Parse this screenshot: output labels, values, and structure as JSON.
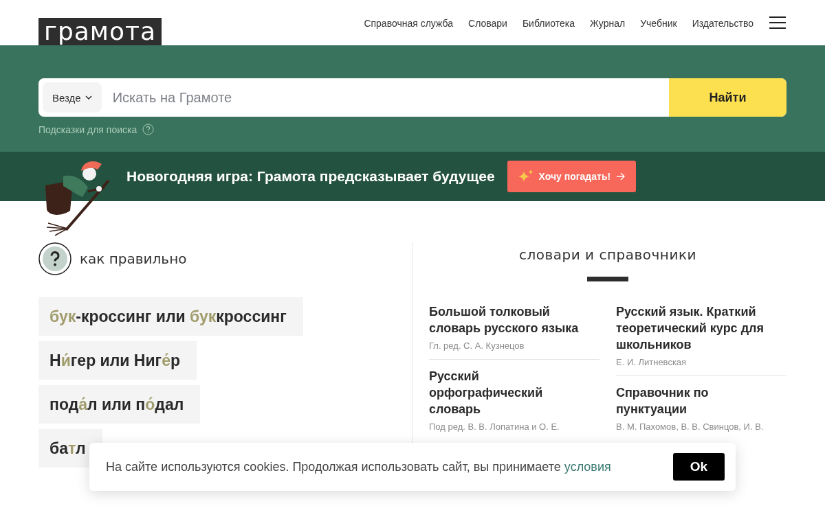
{
  "logo": "грамота",
  "nav": [
    "Справочная служба",
    "Словари",
    "Библиотека",
    "Журнал",
    "Учебник",
    "Издательство"
  ],
  "search": {
    "scope": "Везде",
    "placeholder": "Искать на Грамоте",
    "button": "Найти",
    "hint": "Подсказки для поиска"
  },
  "promo": {
    "text": "Новогодняя игра: Грамота предсказывает будущее",
    "button": "Хочу погадать!"
  },
  "how_to": {
    "title": "как правильно",
    "items": [
      {
        "parts": [
          {
            "text": "бук",
            "accent": true
          },
          {
            "text": "-кроссинг или ",
            "accent": false
          },
          {
            "text": "бук",
            "accent": true
          },
          {
            "text": "кроссинг",
            "accent": false
          }
        ]
      },
      {
        "parts": [
          {
            "text": "Н",
            "accent": false
          },
          {
            "text": "и́",
            "accent": true
          },
          {
            "text": "гер или Ниг",
            "accent": false
          },
          {
            "text": "е́",
            "accent": true
          },
          {
            "text": "р",
            "accent": false
          }
        ]
      },
      {
        "parts": [
          {
            "text": "под",
            "accent": false
          },
          {
            "text": "а́",
            "accent": true
          },
          {
            "text": "л или п",
            "accent": false
          },
          {
            "text": "о́",
            "accent": true
          },
          {
            "text": "дал",
            "accent": false
          }
        ]
      },
      {
        "parts": [
          {
            "text": "ба",
            "accent": false
          },
          {
            "text": "т",
            "accent": true
          },
          {
            "text": "л",
            "accent": false
          }
        ]
      }
    ]
  },
  "dictionaries": {
    "title": "словари и справочники",
    "columns": [
      [
        {
          "title": "Большой толковый словарь русского языка",
          "author": "Гл. ред. С. А. Кузнецов"
        },
        {
          "title": "Русский орфографический словарь",
          "author": "Под ред. В. В. Лопатина и О. Е."
        }
      ],
      [
        {
          "title": "Русский язык. Краткий теоретический курс для школьников",
          "author": "Е. И. Литневская"
        },
        {
          "title": "Справочник по пунктуации",
          "author": "В. М. Пахомов, В. В. Свинцов, И. В."
        }
      ]
    ]
  },
  "cookie": {
    "text": "На сайте используются cookies. Продолжая использовать сайт, вы принимаете ",
    "link": "условия",
    "button": "Ok"
  }
}
